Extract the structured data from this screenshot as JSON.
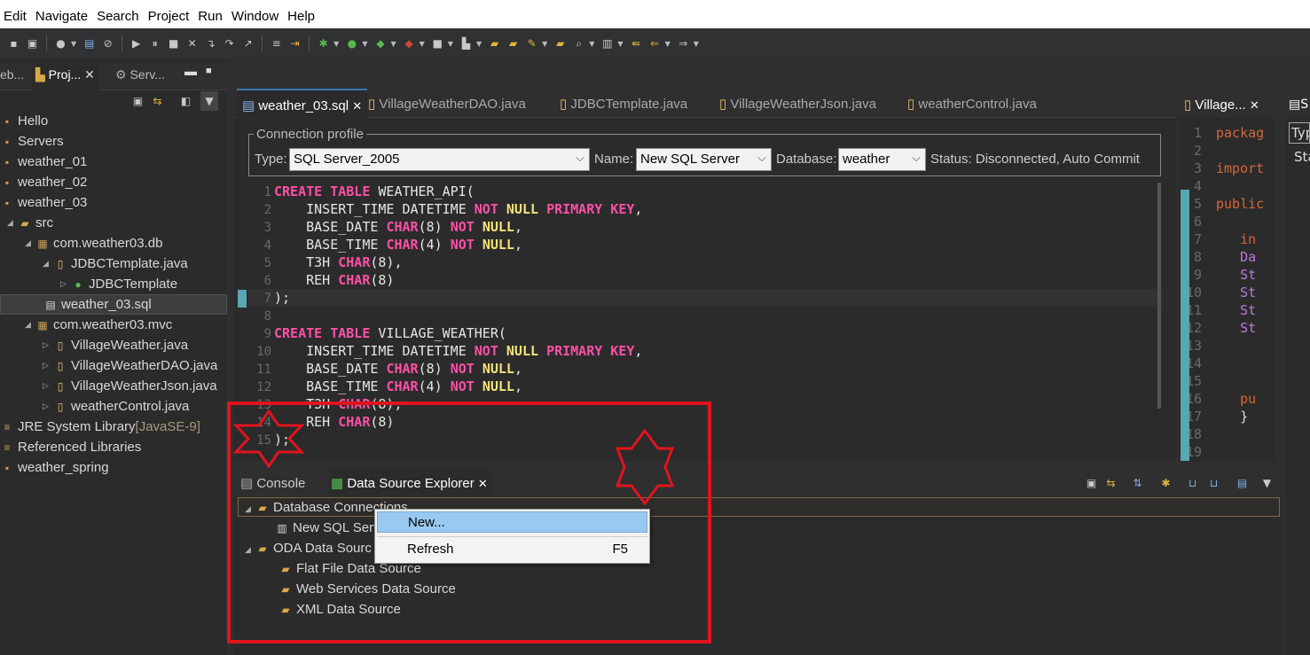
{
  "menu": [
    "Edit",
    "Navigate",
    "Search",
    "Project",
    "Run",
    "Window",
    "Help"
  ],
  "left_tabs": {
    "tab1": "eb...",
    "tab2": "Proj...",
    "tab3": "Serv..."
  },
  "tree": [
    {
      "label": "Hello",
      "indent": 0,
      "icon": "project-icon"
    },
    {
      "label": "Servers",
      "indent": 0,
      "icon": "project-icon"
    },
    {
      "label": "weather_01",
      "indent": 0,
      "icon": "project-icon"
    },
    {
      "label": "weather_02",
      "indent": 0,
      "icon": "project-icon"
    },
    {
      "label": "weather_03",
      "indent": 0,
      "icon": "project-icon"
    },
    {
      "label": "src",
      "indent": 1,
      "icon": "folder-icon"
    },
    {
      "label": "com.weather03.db",
      "indent": 2,
      "icon": "package-icon"
    },
    {
      "label": "JDBCTemplate.java",
      "indent": 3,
      "icon": "java-file-icon"
    },
    {
      "label": "JDBCTemplate",
      "indent": 4,
      "icon": "class-icon"
    },
    {
      "label": "weather_03.sql",
      "indent": 3,
      "icon": "sql-file-icon"
    },
    {
      "label": "com.weather03.mvc",
      "indent": 2,
      "icon": "package-icon"
    },
    {
      "label": "VillageWeather.java",
      "indent": 3,
      "icon": "java-file-icon"
    },
    {
      "label": "VillageWeatherDAO.java",
      "indent": 3,
      "icon": "java-file-icon"
    },
    {
      "label": "VillageWeatherJson.java",
      "indent": 3,
      "icon": "java-file-icon"
    },
    {
      "label": "weatherControl.java",
      "indent": 3,
      "icon": "java-file-icon"
    },
    {
      "label": "JRE System Library",
      "suffix": "[JavaSE-9]",
      "indent": 0,
      "icon": "library-icon"
    },
    {
      "label": "Referenced Libraries",
      "indent": 0,
      "icon": "library-icon"
    },
    {
      "label": "weather_spring",
      "indent": 0,
      "icon": "project-icon"
    }
  ],
  "editor_tabs": [
    "weather_03.sql",
    "VillageWeatherDAO.java",
    "JDBCTemplate.java",
    "VillageWeatherJson.java",
    "weatherControl.java"
  ],
  "connection": {
    "legend": "Connection profile",
    "type_label": "Type:",
    "type_value": "SQL Server_2005",
    "name_label": "Name:",
    "name_value": "New SQL Server",
    "db_label": "Database:",
    "db_value": "weather",
    "status": "Status: Disconnected, Auto Commit"
  },
  "code_lines": [
    {
      "n": "1",
      "t": [
        [
          "kw",
          "CREATE TABLE "
        ],
        [
          "tx",
          "WEATHER_API("
        ]
      ]
    },
    {
      "n": "2",
      "t": [
        [
          "tx",
          "    INSERT_TIME DATETIME "
        ],
        [
          "kw",
          "NOT "
        ],
        [
          "kw2",
          "NULL "
        ],
        [
          "kw",
          "PRIMARY KEY"
        ],
        [
          "tx",
          ","
        ]
      ]
    },
    {
      "n": "3",
      "t": [
        [
          "tx",
          "    BASE_DATE "
        ],
        [
          "kw",
          "CHAR"
        ],
        [
          "tx",
          "(8) "
        ],
        [
          "kw",
          "NOT "
        ],
        [
          "kw2",
          "NULL"
        ],
        [
          "tx",
          ","
        ]
      ]
    },
    {
      "n": "4",
      "t": [
        [
          "tx",
          "    BASE_TIME "
        ],
        [
          "kw",
          "CHAR"
        ],
        [
          "tx",
          "(4) "
        ],
        [
          "kw",
          "NOT "
        ],
        [
          "kw2",
          "NULL"
        ],
        [
          "tx",
          ","
        ]
      ]
    },
    {
      "n": "5",
      "t": [
        [
          "tx",
          "    T3H "
        ],
        [
          "kw",
          "CHAR"
        ],
        [
          "tx",
          "(8),"
        ]
      ]
    },
    {
      "n": "6",
      "t": [
        [
          "tx",
          "    REH "
        ],
        [
          "kw",
          "CHAR"
        ],
        [
          "tx",
          "(8)"
        ]
      ]
    },
    {
      "n": "7",
      "t": [
        [
          "tx",
          ");"
        ]
      ]
    },
    {
      "n": "8",
      "t": []
    },
    {
      "n": "9",
      "t": [
        [
          "kw",
          "CREATE TABLE "
        ],
        [
          "tx",
          "VILLAGE_WEATHER("
        ]
      ]
    },
    {
      "n": "10",
      "t": [
        [
          "tx",
          "    INSERT_TIME DATETIME "
        ],
        [
          "kw",
          "NOT "
        ],
        [
          "kw2",
          "NULL "
        ],
        [
          "kw",
          "PRIMARY KEY"
        ],
        [
          "tx",
          ","
        ]
      ]
    },
    {
      "n": "11",
      "t": [
        [
          "tx",
          "    BASE_DATE "
        ],
        [
          "kw",
          "CHAR"
        ],
        [
          "tx",
          "(8) "
        ],
        [
          "kw",
          "NOT "
        ],
        [
          "kw2",
          "NULL"
        ],
        [
          "tx",
          ","
        ]
      ]
    },
    {
      "n": "12",
      "t": [
        [
          "tx",
          "    BASE_TIME "
        ],
        [
          "kw",
          "CHAR"
        ],
        [
          "tx",
          "(4) "
        ],
        [
          "kw",
          "NOT "
        ],
        [
          "kw2",
          "NULL"
        ],
        [
          "tx",
          ","
        ]
      ]
    },
    {
      "n": "13",
      "t": [
        [
          "tx",
          "    T3H "
        ],
        [
          "kw",
          "CHAR"
        ],
        [
          "tx",
          "(8),"
        ]
      ]
    },
    {
      "n": "14",
      "t": [
        [
          "tx",
          "    REH "
        ],
        [
          "kw",
          "CHAR"
        ],
        [
          "tx",
          "(8)"
        ]
      ]
    },
    {
      "n": "15",
      "t": [
        [
          "tx",
          ");"
        ]
      ]
    }
  ],
  "right_editor": {
    "tab": "Village...",
    "lines": [
      [
        "1",
        "packag",
        "rk"
      ],
      [
        "2",
        "",
        ""
      ],
      [
        "3",
        "import",
        "rk"
      ],
      [
        "4",
        "",
        ""
      ],
      [
        "5",
        "public",
        "rk"
      ],
      [
        "6",
        "",
        ""
      ],
      [
        "7",
        "   in",
        "rk"
      ],
      [
        "8",
        "   Da",
        "rt"
      ],
      [
        "9",
        "   St",
        "rt"
      ],
      [
        "10",
        "   St",
        "rt"
      ],
      [
        "11",
        "   St",
        "rt"
      ],
      [
        "12",
        "   St",
        "rt"
      ],
      [
        "13",
        "",
        ""
      ],
      [
        "14",
        "",
        ""
      ],
      [
        "15",
        "",
        ""
      ],
      [
        "16",
        "   pu",
        "rk"
      ],
      [
        "17",
        "   }",
        ""
      ],
      [
        "18",
        "",
        ""
      ],
      [
        "19",
        "",
        ""
      ]
    ]
  },
  "far_right": {
    "tab": "S",
    "field": "Typ",
    "label": "Sta"
  },
  "bottom_tabs": {
    "console": "Console",
    "dse": "Data Source Explorer"
  },
  "dse_tree": [
    {
      "label": "Database Connections",
      "icon": "folder-icon"
    },
    {
      "label": "New SQL Serv",
      "icon": "database-icon"
    },
    {
      "label": "ODA Data Sourc",
      "icon": "folder-icon"
    },
    {
      "label": "Flat File Data Source",
      "icon": "folder-icon"
    },
    {
      "label": "Web Services Data Source",
      "icon": "folder-icon"
    },
    {
      "label": "XML Data Source",
      "icon": "folder-icon"
    }
  ],
  "context_menu": {
    "new": "New...",
    "refresh": "Refresh",
    "refresh_key": "F5"
  },
  "colors": {
    "annotation_red": "#e0141e",
    "selection_blue": "#99c9ef",
    "keyword": "#ff4fa6",
    "null_kw": "#f5e37a"
  }
}
